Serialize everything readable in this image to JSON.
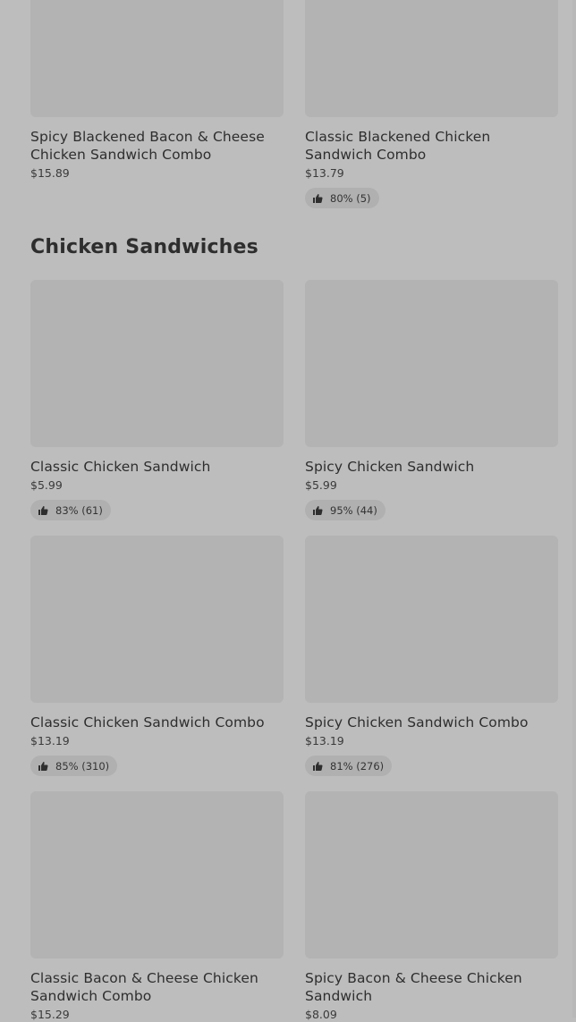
{
  "top_items": [
    {
      "name": "Spicy Blackened Bacon & Cheese Chicken Sandwich Combo",
      "price": "$15.89",
      "rating": ""
    },
    {
      "name": "Classic Blackened Chicken Sandwich Combo",
      "price": "$13.79",
      "rating": "80% (5)"
    }
  ],
  "section": {
    "title": "Chicken Sandwiches",
    "items": [
      {
        "name": "Classic Chicken Sandwich",
        "price": "$5.99",
        "rating": "83% (61)"
      },
      {
        "name": "Spicy Chicken Sandwich",
        "price": "$5.99",
        "rating": "95% (44)"
      },
      {
        "name": "Classic Chicken Sandwich Combo",
        "price": "$13.19",
        "rating": "85% (310)"
      },
      {
        "name": "Spicy Chicken Sandwich Combo",
        "price": "$13.19",
        "rating": "81% (276)"
      },
      {
        "name": "Classic Bacon & Cheese Chicken Sandwich Combo",
        "price": "$15.29",
        "rating": ""
      },
      {
        "name": "Spicy Bacon & Cheese Chicken Sandwich",
        "price": "$8.09",
        "rating": ""
      }
    ]
  },
  "icons": {
    "rating": "thumbs-up-icon"
  },
  "colors": {
    "background": "#bdbdbd",
    "image_placeholder": "#b3b3b3",
    "badge": "#b0b0b0"
  }
}
